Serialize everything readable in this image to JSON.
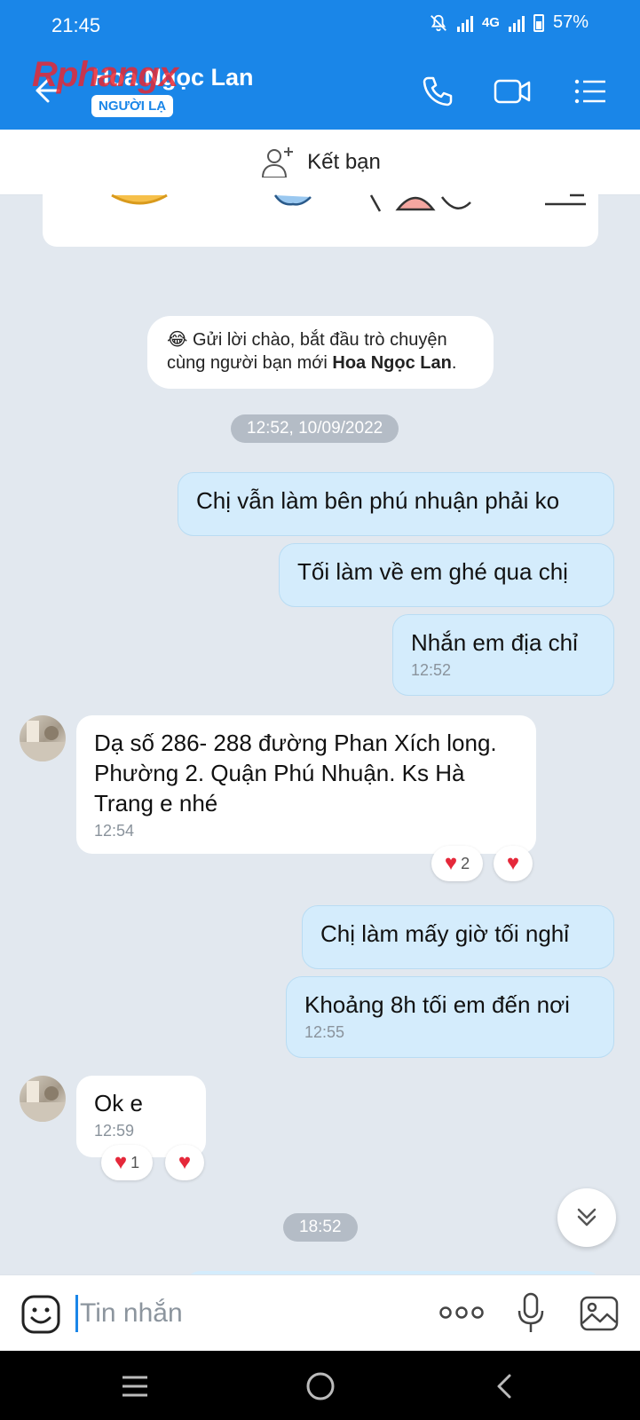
{
  "status_bar": {
    "time": "21:45",
    "network": "4G",
    "battery": "57%"
  },
  "header": {
    "contact_name": "Hoa Ngọc Lan",
    "badge": "NGƯỜI LẠ",
    "watermark": "Rphangx",
    "icons": [
      "back-arrow-icon",
      "phone-icon",
      "video-call-icon",
      "menu-list-icon"
    ]
  },
  "add_friend": {
    "label": "Kết bạn",
    "icon": "add-person-icon"
  },
  "system_message": {
    "emoji": "😂",
    "line1": "Gửi lời chào, bắt đầu trò chuyện",
    "line2_prefix": "cùng người bạn mới ",
    "name": "Hoa Ngọc Lan",
    "line2_suffix": "."
  },
  "messages": {
    "date1": "12:52, 10/09/2022",
    "m1": "Chị vẫn làm bên phú nhuận phải ko",
    "m2": "Tối làm về em ghé qua chị",
    "m3": {
      "text": "Nhắn em địa chỉ",
      "time": "12:52"
    },
    "m4": {
      "text": "Dạ số 286- 288 đường Phan Xích long. Phường 2. Quận Phú Nhuận. Ks Hà Trang e  nhé",
      "time": "12:54",
      "reaction_count": "2"
    },
    "m5": "Chị làm mấy giờ tối nghỉ",
    "m6": {
      "text": "Khoảng 8h tối em đến nơi",
      "time": "12:55"
    },
    "m7": {
      "text": "Ok e",
      "time": "12:59",
      "reaction_count": "1"
    },
    "date2": "18:52"
  },
  "input": {
    "placeholder": "Tin nhắn"
  },
  "colors": {
    "accent": "#1a86e8",
    "my_bubble": "#d4ecfc",
    "chat_bg": "#e2e8ef",
    "heart": "#e5283a"
  }
}
